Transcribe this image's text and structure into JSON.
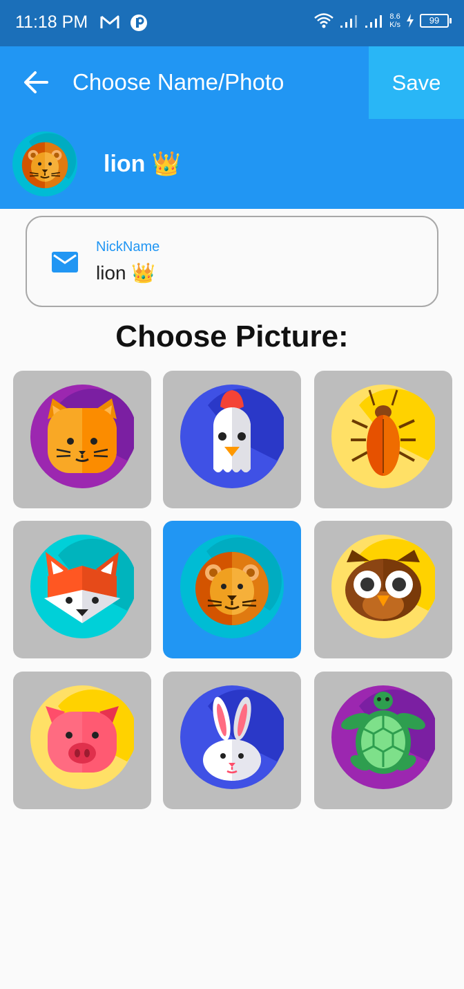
{
  "status_bar": {
    "time": "11:18 PM",
    "speed_value": "8.6",
    "speed_unit": "K/s",
    "battery": "99"
  },
  "app_bar": {
    "title": "Choose Name/Photo",
    "save_label": "Save"
  },
  "profile": {
    "name": "lion 👑",
    "avatar": "lion"
  },
  "nickname_field": {
    "label": "NickName",
    "value": "lion 👑",
    "icon": "mail-icon"
  },
  "picture_section": {
    "heading": "Choose Picture:",
    "selected": "lion",
    "options": [
      "cat",
      "chicken",
      "cockroach",
      "fox",
      "lion",
      "owl",
      "pig",
      "rabbit",
      "turtle"
    ]
  },
  "colors": {
    "status_bar": "#1b6fb9",
    "app_bar": "#2196f3",
    "save_button": "#29b6f6",
    "tile": "#bdbdbd",
    "tile_selected": "#2196f3",
    "label_accent": "#2196f3"
  }
}
